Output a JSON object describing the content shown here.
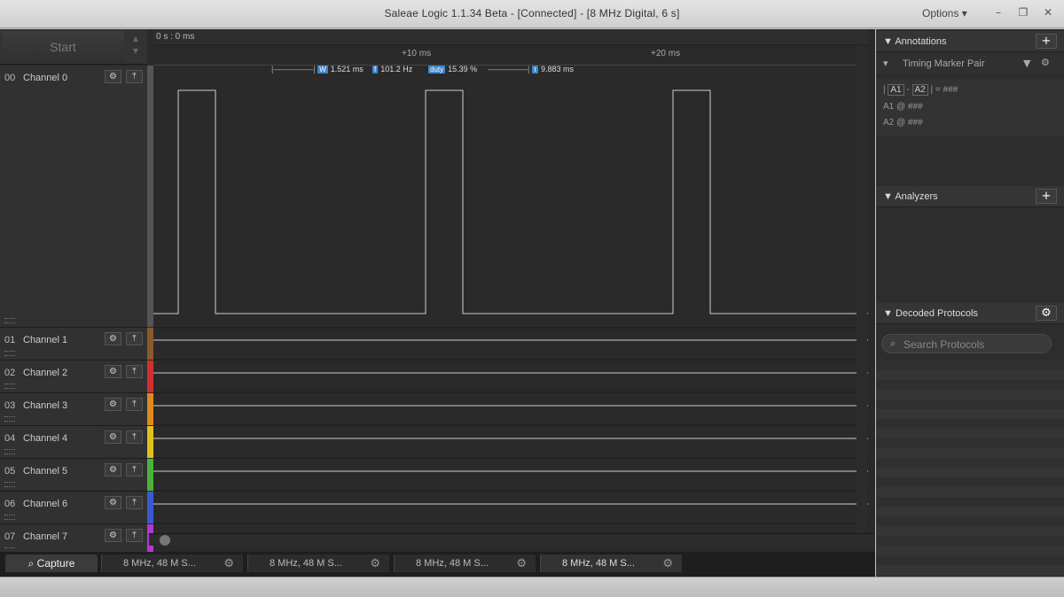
{
  "window": {
    "title": "Saleae Logic 1.1.34 Beta - [Connected] - [8 MHz Digital, 6 s]",
    "options_label": "Options ▾",
    "minimize": "–",
    "restore": "❐",
    "close": "✕"
  },
  "toolbar": {
    "start_label": "Start"
  },
  "timeline": {
    "origin": "0 s : 0 ms",
    "ticks": [
      "+10 ms",
      "+20 ms"
    ]
  },
  "measurements": {
    "width_tag": "W",
    "width_value": "1.521 ms",
    "freq_tag": "f",
    "freq_value": "101.2 Hz",
    "duty_tag": "duty",
    "duty_value": "15.39 %",
    "period_tag": "τ",
    "period_value": "9.883 ms"
  },
  "channels": [
    {
      "num": "00",
      "name": "Channel 0",
      "color": "#555555"
    },
    {
      "num": "01",
      "name": "Channel 1",
      "color": "#8a5a2b"
    },
    {
      "num": "02",
      "name": "Channel 2",
      "color": "#d23030"
    },
    {
      "num": "03",
      "name": "Channel 3",
      "color": "#e08a1a"
    },
    {
      "num": "04",
      "name": "Channel 4",
      "color": "#e0c21a"
    },
    {
      "num": "05",
      "name": "Channel 5",
      "color": "#4ab33a"
    },
    {
      "num": "06",
      "name": "Channel 6",
      "color": "#3a5ad0"
    },
    {
      "num": "07",
      "name": "Channel 7",
      "color": "#b03ad0"
    }
  ],
  "annotations": {
    "header": "Annotations",
    "marker_pair": "Timing Marker Pair",
    "formula_a1": "A1",
    "formula_a2": "A2",
    "formula_result": "= ###",
    "row1": "A1  @  ###",
    "row2": "A2  @  ###"
  },
  "analyzers": {
    "header": "Analyzers"
  },
  "decoded": {
    "header": "Decoded Protocols",
    "search_placeholder": "Search Protocols"
  },
  "bottom_tabs": {
    "capture_label": "Capture",
    "sessions": [
      "8 MHz, 48 M S...",
      "8 MHz, 48 M S...",
      "8 MHz, 48 M S...",
      "8 MHz, 48 M S..."
    ]
  }
}
